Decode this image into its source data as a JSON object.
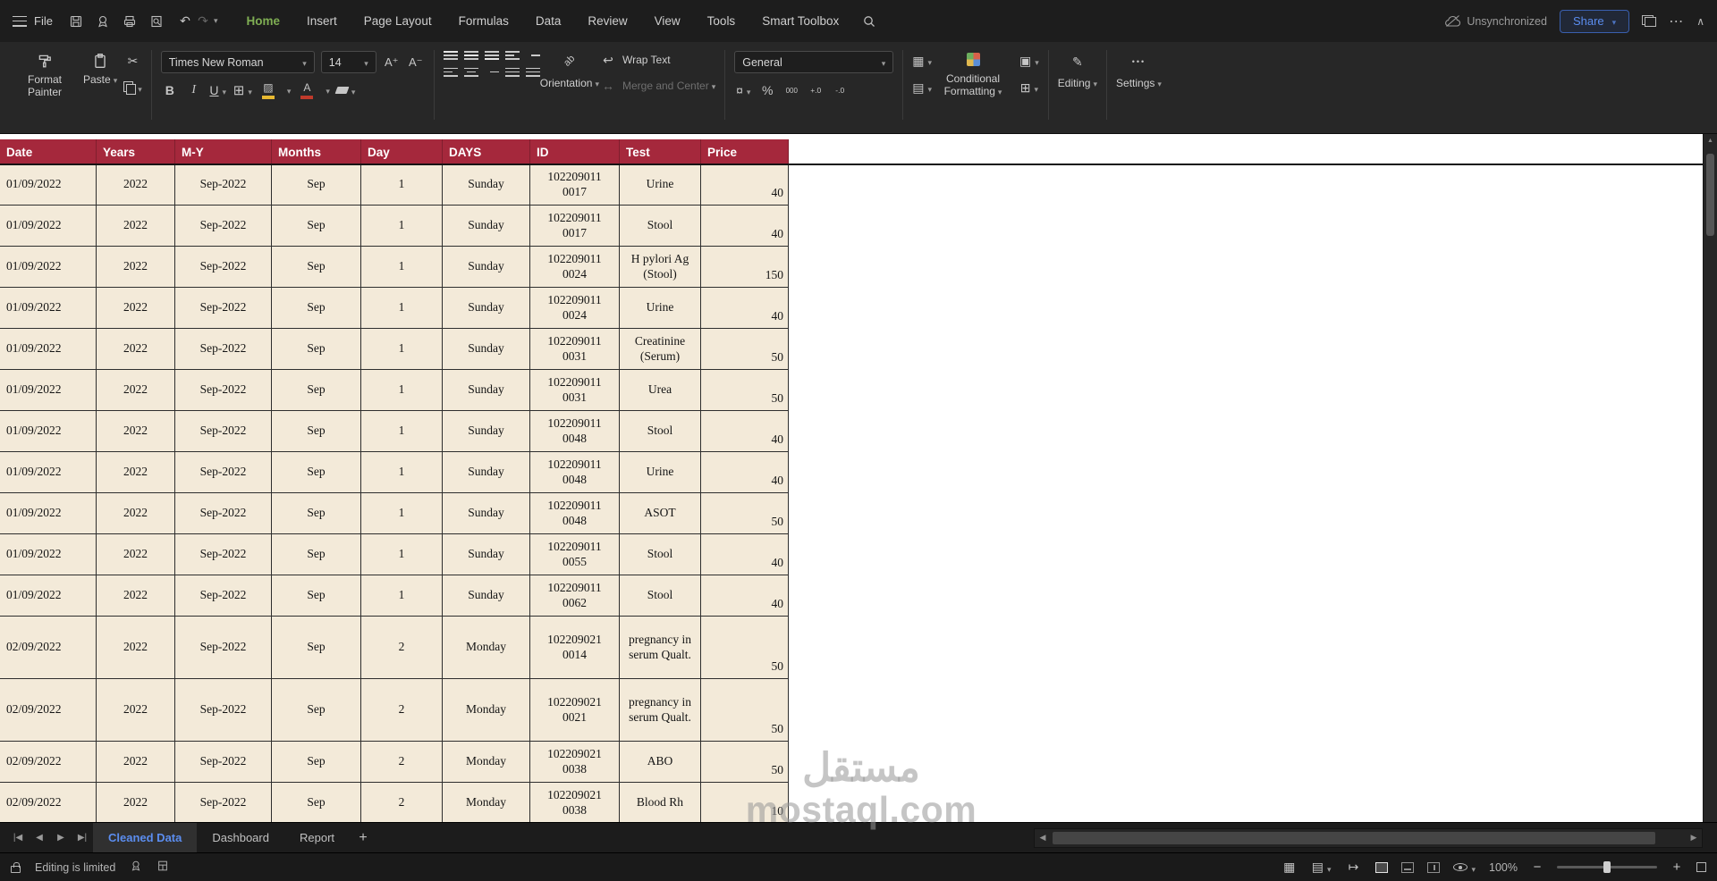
{
  "titlebar": {
    "file": "File",
    "menus": [
      "Home",
      "Insert",
      "Page Layout",
      "Formulas",
      "Data",
      "Review",
      "View",
      "Tools",
      "Smart Toolbox"
    ],
    "active": "Home",
    "sync": "Unsynchronized",
    "share": "Share"
  },
  "ribbon": {
    "format_painter": "Format Painter",
    "paste": "Paste",
    "font_name": "Times New Roman",
    "font_size": "14",
    "bold": "B",
    "italic": "I",
    "underline": "U",
    "orientation": "Orientation",
    "wrap_text": "Wrap Text",
    "merge_center": "Merge and Center",
    "number_format": "General",
    "conditional_formatting": "Conditional Formatting",
    "editing": "Editing",
    "settings": "Settings"
  },
  "table": {
    "headers": [
      "Date",
      "Years",
      "M-Y",
      "Months",
      "Day",
      "DAYS",
      "ID",
      "Test",
      "Price"
    ],
    "rows": [
      [
        "01/09/2022",
        "2022",
        "Sep-2022",
        "Sep",
        "1",
        "Sunday",
        "102209011\n0017",
        "Urine",
        "40"
      ],
      [
        "01/09/2022",
        "2022",
        "Sep-2022",
        "Sep",
        "1",
        "Sunday",
        "102209011\n0017",
        "Stool",
        "40"
      ],
      [
        "01/09/2022",
        "2022",
        "Sep-2022",
        "Sep",
        "1",
        "Sunday",
        "102209011\n0024",
        "H pylori Ag (Stool)",
        "150"
      ],
      [
        "01/09/2022",
        "2022",
        "Sep-2022",
        "Sep",
        "1",
        "Sunday",
        "102209011\n0024",
        "Urine",
        "40"
      ],
      [
        "01/09/2022",
        "2022",
        "Sep-2022",
        "Sep",
        "1",
        "Sunday",
        "102209011\n0031",
        "Creatinine (Serum)",
        "50"
      ],
      [
        "01/09/2022",
        "2022",
        "Sep-2022",
        "Sep",
        "1",
        "Sunday",
        "102209011\n0031",
        "Urea",
        "50"
      ],
      [
        "01/09/2022",
        "2022",
        "Sep-2022",
        "Sep",
        "1",
        "Sunday",
        "102209011\n0048",
        "Stool",
        "40"
      ],
      [
        "01/09/2022",
        "2022",
        "Sep-2022",
        "Sep",
        "1",
        "Sunday",
        "102209011\n0048",
        "Urine",
        "40"
      ],
      [
        "01/09/2022",
        "2022",
        "Sep-2022",
        "Sep",
        "1",
        "Sunday",
        "102209011\n0048",
        "ASOT",
        "50"
      ],
      [
        "01/09/2022",
        "2022",
        "Sep-2022",
        "Sep",
        "1",
        "Sunday",
        "102209011\n0055",
        "Stool",
        "40"
      ],
      [
        "01/09/2022",
        "2022",
        "Sep-2022",
        "Sep",
        "1",
        "Sunday",
        "102209011\n0062",
        "Stool",
        "40"
      ],
      [
        "02/09/2022",
        "2022",
        "Sep-2022",
        "Sep",
        "2",
        "Monday",
        "102209021\n0014",
        "pregnancy in serum Qualt.",
        "50"
      ],
      [
        "02/09/2022",
        "2022",
        "Sep-2022",
        "Sep",
        "2",
        "Monday",
        "102209021\n0021",
        "pregnancy in serum Qualt.",
        "50"
      ],
      [
        "02/09/2022",
        "2022",
        "Sep-2022",
        "Sep",
        "2",
        "Monday",
        "102209021\n0038",
        "ABO",
        "50"
      ],
      [
        "02/09/2022",
        "2022",
        "Sep-2022",
        "Sep",
        "2",
        "Monday",
        "102209021\n0038",
        "Blood Rh",
        "10"
      ]
    ]
  },
  "tabbar": {
    "tabs": [
      {
        "label": "Cleaned Data",
        "active": true
      },
      {
        "label": "Dashboard",
        "active": false
      },
      {
        "label": "Report",
        "active": false
      }
    ],
    "add": "+"
  },
  "statusbar": {
    "message": "Editing is limited",
    "zoom": "100%"
  },
  "watermark": {
    "line1": "مستقل",
    "line2": "mostaql.com"
  }
}
